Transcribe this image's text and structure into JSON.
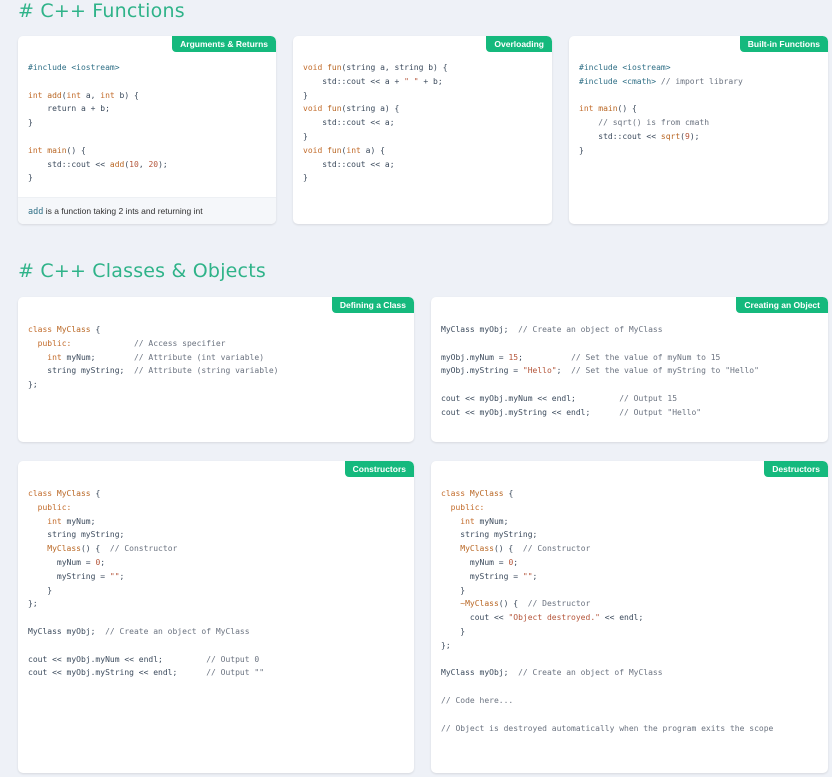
{
  "sections": {
    "functions": "# C++ Functions",
    "classes": "# C++ Classes & Objects"
  },
  "cards": {
    "args": {
      "tag": "Arguments & Returns",
      "lines": [
        [
          [
            "pp",
            "#include <iostream>"
          ]
        ],
        [],
        [
          [
            "kw",
            "int "
          ],
          [
            "fn",
            "add"
          ],
          [
            "",
            "("
          ],
          [
            "kw",
            "int "
          ],
          [
            "",
            "a, "
          ],
          [
            "kw",
            "int "
          ],
          [
            "",
            "b) {"
          ]
        ],
        [
          [
            "",
            "    return a + b;"
          ]
        ],
        [
          [
            "",
            "}"
          ]
        ],
        [],
        [
          [
            "kw",
            "int "
          ],
          [
            "fn",
            "main"
          ],
          [
            "",
            "() {"
          ]
        ],
        [
          [
            "",
            "    std::cout << "
          ],
          [
            "fn",
            "add"
          ],
          [
            "",
            "("
          ],
          [
            "num",
            "10"
          ],
          [
            "",
            ", "
          ],
          [
            "num",
            "20"
          ],
          [
            "",
            ");"
          ]
        ],
        [
          [
            "",
            "}"
          ]
        ]
      ],
      "footer_code": "add",
      "footer_text": " is a function taking 2 ints and returning int"
    },
    "overloading": {
      "tag": "Overloading",
      "lines": [
        [
          [
            "kw",
            "void "
          ],
          [
            "fn",
            "fun"
          ],
          [
            "",
            "(string a, string b) {"
          ]
        ],
        [
          [
            "",
            "    std::cout << a + "
          ],
          [
            "str",
            "\" \""
          ],
          [
            "",
            " + b;"
          ]
        ],
        [
          [
            "",
            "}"
          ]
        ],
        [
          [
            "kw",
            "void "
          ],
          [
            "fn",
            "fun"
          ],
          [
            "",
            "(string a) {"
          ]
        ],
        [
          [
            "",
            "    std::cout << a;"
          ]
        ],
        [
          [
            "",
            "}"
          ]
        ],
        [
          [
            "kw",
            "void "
          ],
          [
            "fn",
            "fun"
          ],
          [
            "",
            "("
          ],
          [
            "kw",
            "int "
          ],
          [
            "",
            "a) {"
          ]
        ],
        [
          [
            "",
            "    std::cout << a;"
          ]
        ],
        [
          [
            "",
            "}"
          ]
        ]
      ]
    },
    "builtin": {
      "tag": "Built-in Functions",
      "lines": [
        [
          [
            "pp",
            "#include <iostream>"
          ]
        ],
        [
          [
            "pp",
            "#include <cmath> "
          ],
          [
            "cm",
            "// import library"
          ]
        ],
        [],
        [
          [
            "kw",
            "int "
          ],
          [
            "fn",
            "main"
          ],
          [
            "",
            "() {"
          ]
        ],
        [
          [
            "cm",
            "    // sqrt() is from cmath"
          ]
        ],
        [
          [
            "",
            "    std::cout << "
          ],
          [
            "fn",
            "sqrt"
          ],
          [
            "",
            "("
          ],
          [
            "num",
            "9"
          ],
          [
            "",
            ");"
          ]
        ],
        [
          [
            "",
            "}"
          ]
        ]
      ]
    },
    "defining": {
      "tag": "Defining a Class",
      "lines": [
        [
          [
            "kw",
            "class "
          ],
          [
            "fn",
            "MyClass"
          ],
          [
            "",
            " {"
          ]
        ],
        [
          [
            "kw",
            "  public:"
          ],
          [
            "",
            "             "
          ],
          [
            "cm",
            "// Access specifier"
          ]
        ],
        [
          [
            "kw",
            "    int "
          ],
          [
            "",
            "myNum;        "
          ],
          [
            "cm",
            "// Attribute (int variable)"
          ]
        ],
        [
          [
            "",
            "    string myString;  "
          ],
          [
            "cm",
            "// Attribute (string variable)"
          ]
        ],
        [
          [
            "",
            "};"
          ]
        ]
      ]
    },
    "creating": {
      "tag": "Creating an Object",
      "lines": [
        [
          [
            "",
            "MyClass myObj;  "
          ],
          [
            "cm",
            "// Create an object of MyClass"
          ]
        ],
        [],
        [
          [
            "",
            "myObj.myNum = "
          ],
          [
            "num",
            "15"
          ],
          [
            "",
            ";          "
          ],
          [
            "cm",
            "// Set the value of myNum to 15"
          ]
        ],
        [
          [
            "",
            "myObj.myString = "
          ],
          [
            "str",
            "\"Hello\""
          ],
          [
            "",
            ";  "
          ],
          [
            "cm",
            "// Set the value of myString to \"Hello\""
          ]
        ],
        [],
        [
          [
            "",
            "cout << myObj.myNum << endl;         "
          ],
          [
            "cm",
            "// Output 15"
          ]
        ],
        [
          [
            "",
            "cout << myObj.myString << endl;      "
          ],
          [
            "cm",
            "// Output \"Hello\""
          ]
        ]
      ]
    },
    "constructors": {
      "tag": "Constructors",
      "lines": [
        [
          [
            "kw",
            "class "
          ],
          [
            "fn",
            "MyClass"
          ],
          [
            "",
            " {"
          ]
        ],
        [
          [
            "kw",
            "  public:"
          ]
        ],
        [
          [
            "kw",
            "    int "
          ],
          [
            "",
            "myNum;"
          ]
        ],
        [
          [
            "",
            "    string myString;"
          ]
        ],
        [
          [
            "fn",
            "    MyClass"
          ],
          [
            "",
            "() {  "
          ],
          [
            "cm",
            "// Constructor"
          ]
        ],
        [
          [
            "",
            "      myNum = "
          ],
          [
            "num",
            "0"
          ],
          [
            "",
            ";"
          ]
        ],
        [
          [
            "",
            "      myString = "
          ],
          [
            "str",
            "\"\""
          ],
          [
            "",
            ";"
          ]
        ],
        [
          [
            "",
            "    }"
          ]
        ],
        [
          [
            "",
            "};"
          ]
        ],
        [],
        [
          [
            "",
            "MyClass myObj;  "
          ],
          [
            "cm",
            "// Create an object of MyClass"
          ]
        ],
        [],
        [
          [
            "",
            "cout << myObj.myNum << endl;         "
          ],
          [
            "cm",
            "// Output 0"
          ]
        ],
        [
          [
            "",
            "cout << myObj.myString << endl;      "
          ],
          [
            "cm",
            "// Output \"\""
          ]
        ]
      ]
    },
    "destructors": {
      "tag": "Destructors",
      "lines": [
        [
          [
            "kw",
            "class "
          ],
          [
            "fn",
            "MyClass"
          ],
          [
            "",
            " {"
          ]
        ],
        [
          [
            "kw",
            "  public:"
          ]
        ],
        [
          [
            "kw",
            "    int "
          ],
          [
            "",
            "myNum;"
          ]
        ],
        [
          [
            "",
            "    string myString;"
          ]
        ],
        [
          [
            "fn",
            "    MyClass"
          ],
          [
            "",
            "() {  "
          ],
          [
            "cm",
            "// Constructor"
          ]
        ],
        [
          [
            "",
            "      myNum = "
          ],
          [
            "num",
            "0"
          ],
          [
            "",
            ";"
          ]
        ],
        [
          [
            "",
            "      myString = "
          ],
          [
            "str",
            "\"\""
          ],
          [
            "",
            ";"
          ]
        ],
        [
          [
            "",
            "    }"
          ]
        ],
        [
          [
            "fn",
            "    ~MyClass"
          ],
          [
            "",
            "() {  "
          ],
          [
            "cm",
            "// Destructor"
          ]
        ],
        [
          [
            "",
            "      cout << "
          ],
          [
            "str",
            "\"Object destroyed.\""
          ],
          [
            "",
            " << endl;"
          ]
        ],
        [
          [
            "",
            "    }"
          ]
        ],
        [
          [
            "",
            "};"
          ]
        ],
        [],
        [
          [
            "",
            "MyClass myObj;  "
          ],
          [
            "cm",
            "// Create an object of MyClass"
          ]
        ],
        [],
        [
          [
            "cm",
            "// Code here..."
          ]
        ],
        [],
        [
          [
            "cm",
            "// Object is destroyed automatically when the program exits the scope"
          ]
        ]
      ]
    }
  }
}
